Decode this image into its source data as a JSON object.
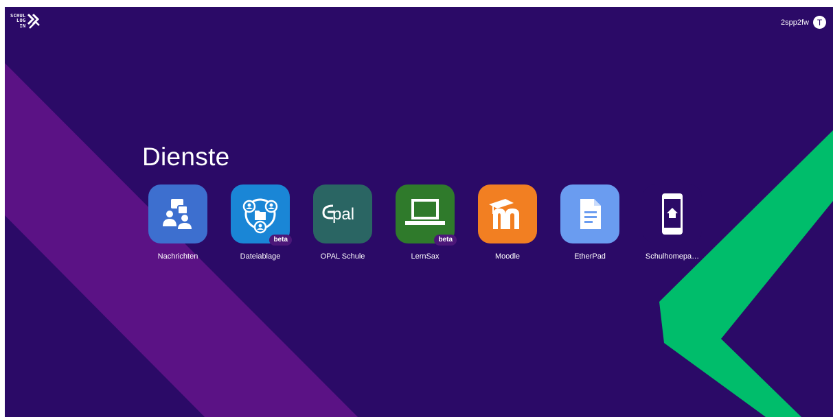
{
  "header": {
    "logo_lines": [
      "SCHUL",
      "LOG",
      "IN"
    ],
    "username": "2spp2fw",
    "avatar_initial": "T"
  },
  "main": {
    "title": "Dienste",
    "services": [
      {
        "label": "Nachrichten",
        "icon": "chat-people-icon",
        "color": "#3d6fcf",
        "badge": ""
      },
      {
        "label": "Dateiablage",
        "icon": "shared-folder-icon",
        "color": "#1a86d6",
        "badge": "beta"
      },
      {
        "label": "OPAL Schule",
        "icon": "opal-logo-icon",
        "icon_text": "pal",
        "color": "#2a6563",
        "badge": ""
      },
      {
        "label": "LernSax",
        "icon": "laptop-icon",
        "color": "#2f7a2b",
        "badge": "beta"
      },
      {
        "label": "Moodle",
        "icon": "moodle-logo-icon",
        "color": "#f27f22",
        "badge": ""
      },
      {
        "label": "EtherPad",
        "icon": "document-icon",
        "color": "#6a9cf0",
        "badge": ""
      },
      {
        "label": "Schulhomepa…",
        "icon": "mobile-home-icon",
        "color": "#2b0a67",
        "badge": ""
      }
    ]
  },
  "colors": {
    "background": "#2b0a67",
    "purple_stripe": "#5b1285",
    "green_chevron": "#00bd6b",
    "badge": "#4c1779"
  }
}
